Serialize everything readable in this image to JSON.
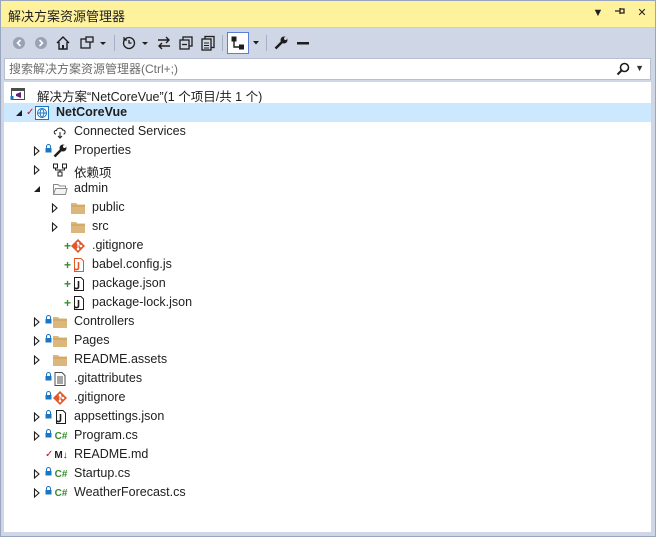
{
  "window": {
    "title": "解决方案资源管理器"
  },
  "titlebar_controls": [
    {
      "name": "dropdown-icon",
      "glyph": "▼"
    },
    {
      "name": "pin-icon",
      "glyph": "ᐩ"
    },
    {
      "name": "close-icon",
      "glyph": "✕"
    }
  ],
  "search": {
    "placeholder": "搜索解决方案资源管理器(Ctrl+;)"
  },
  "tree": {
    "solution": "解决方案“NetCoreVue”(1 个项目/共 1 个)",
    "project": "NetCoreVue",
    "items": [
      {
        "label": "Connected Services",
        "icon": "connected-services-icon"
      },
      {
        "label": "Properties",
        "icon": "wrench-icon"
      },
      {
        "label": "依赖项",
        "icon": "dependencies-icon"
      },
      {
        "label": "admin",
        "icon": "folder-open-icon"
      },
      {
        "label": "public",
        "icon": "folder-icon"
      },
      {
        "label": "src",
        "icon": "folder-icon"
      },
      {
        "label": ".gitignore",
        "icon": "git-icon",
        "badge": "+"
      },
      {
        "label": "babel.config.js",
        "icon": "js-file-icon",
        "badge": "+"
      },
      {
        "label": "package.json",
        "icon": "json-file-icon",
        "badge": "+"
      },
      {
        "label": "package-lock.json",
        "icon": "json-file-icon",
        "badge": "+"
      },
      {
        "label": "Controllers",
        "icon": "folder-icon",
        "badge": "lock"
      },
      {
        "label": "Pages",
        "icon": "folder-icon",
        "badge": "lock"
      },
      {
        "label": "README.assets",
        "icon": "folder-icon"
      },
      {
        "label": ".gitattributes",
        "icon": "text-file-icon",
        "badge": "lock"
      },
      {
        "label": ".gitignore",
        "icon": "git-icon",
        "badge": "lock"
      },
      {
        "label": "appsettings.json",
        "icon": "json-file-icon",
        "badge": "lock"
      },
      {
        "label": "Program.cs",
        "icon": "csharp-file-icon",
        "icon_text": "C#",
        "badge": "lock"
      },
      {
        "label": "README.md",
        "icon": "markdown-file-icon",
        "icon_text": "M↓",
        "badge": "check"
      },
      {
        "label": "Startup.cs",
        "icon": "csharp-file-icon",
        "icon_text": "C#",
        "badge": "lock"
      },
      {
        "label": "WeatherForecast.cs",
        "icon": "csharp-file-icon",
        "icon_text": "C#",
        "badge": "lock"
      }
    ]
  },
  "colors": {
    "titlebar_bg": "#fff29d",
    "toolbar_bg": "#cfd6e5",
    "selection_bg": "#cce8ff",
    "folder": "#dcb67a",
    "csharp": "#388a34",
    "git": "#e0582b",
    "lock": "#1a75c2",
    "added": "#388a34",
    "check": "#c1121f"
  }
}
